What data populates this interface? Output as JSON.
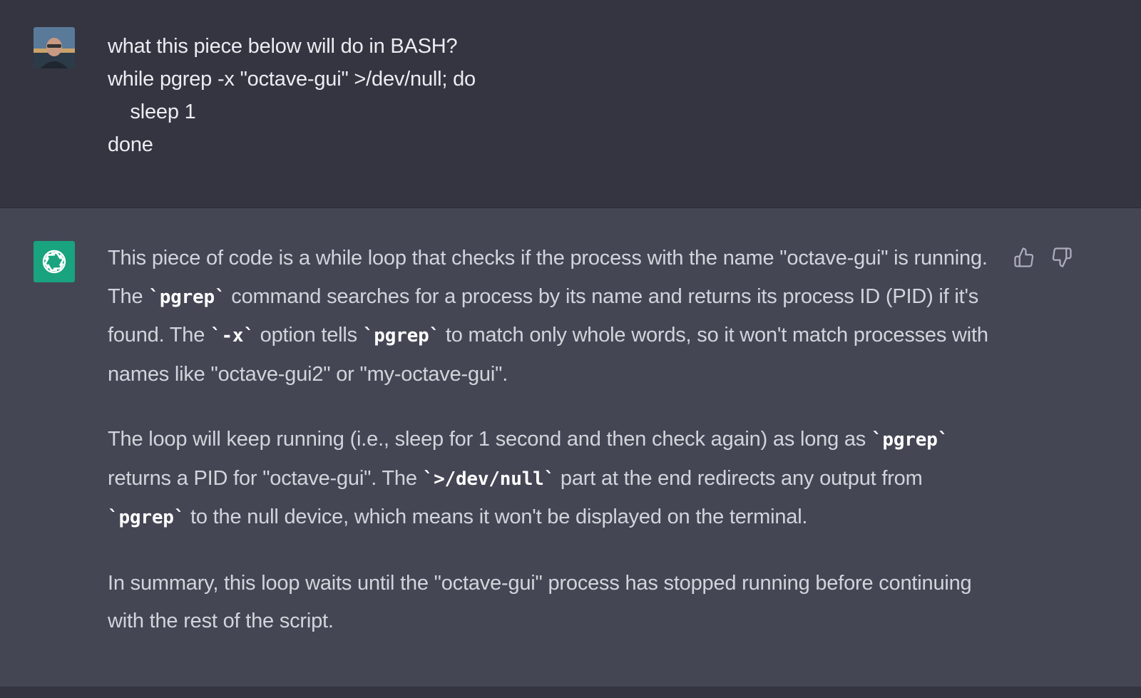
{
  "user_message": {
    "lines": [
      "what this piece below will do in BASH?",
      "while pgrep -x \"octave-gui\" >/dev/null; do",
      "    sleep 1",
      "done"
    ]
  },
  "assistant_message": {
    "p1": {
      "t1": "This piece of code is a while loop that checks if the process with the name \"octave-gui\" is running. The ",
      "c1": "`pgrep`",
      "t2": " command searches for a process by its name and returns its process ID (PID) if it's found. The ",
      "c2": "`-x`",
      "t3": " option tells ",
      "c3": "`pgrep`",
      "t4": " to match only whole words, so it won't match processes with names like \"octave-gui2\" or \"my-octave-gui\"."
    },
    "p2": {
      "t1": "The loop will keep running (i.e., sleep for 1 second and then check again) as long as ",
      "c1": "`pgrep`",
      "t2": " returns a PID for \"octave-gui\". The ",
      "c2": "`>/dev/null`",
      "t3": " part at the end redirects any output from ",
      "c3": "`pgrep`",
      "t4": " to the null device, which means it won't be displayed on the terminal."
    },
    "p3": {
      "t1": "In summary, this loop waits until the \"octave-gui\" process has stopped running before continuing with the rest of the script."
    }
  },
  "icons": {
    "avatar": "user-avatar",
    "logo": "chatgpt-logo-icon",
    "thumbs_up": "thumbs-up-icon",
    "thumbs_down": "thumbs-down-icon"
  },
  "colors": {
    "user_bg": "#343541",
    "assistant_bg": "#444654",
    "logo_bg": "#19a37f",
    "text": "#d1d5db"
  }
}
